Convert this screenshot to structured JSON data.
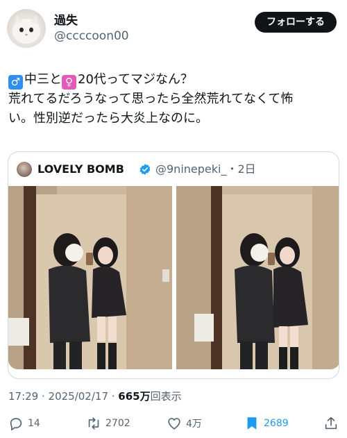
{
  "author": {
    "display_name": "過失",
    "handle": "@ccccoon00"
  },
  "follow_label": "フォローする",
  "tweet": {
    "line1": "中三と",
    "line1b": "20代ってマジなん？",
    "line2": "荒れてるだろうなって思ったら全然荒れてなくて怖",
    "line3": "い。性別逆だったら大炎上なのに。"
  },
  "quoted": {
    "name": "LOVELY BOMB",
    "handle_time": "@9ninepeki_・2日"
  },
  "meta": {
    "timestamp": "17:29 · 2025/02/17 · ",
    "views_count": "665万",
    "views_label": "回表示"
  },
  "actions": {
    "replies": "14",
    "reposts": "2702",
    "likes": "4万",
    "bookmarks": "2689"
  },
  "colors": {
    "accent": "#1d9bf0",
    "text": "#0f1419",
    "muted": "#536471",
    "border": "#cfd9de"
  }
}
